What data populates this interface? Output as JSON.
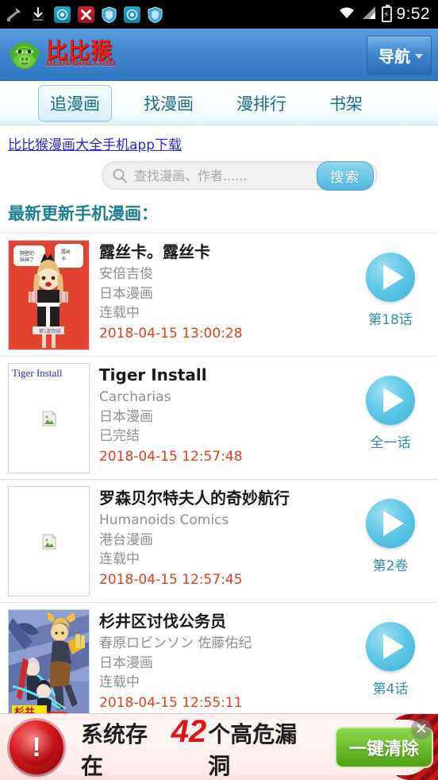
{
  "statusbar": {
    "time": "9:52",
    "icons": [
      "mute-arrow-icon",
      "download-icon",
      "app-cyan-icon",
      "app-red-x-icon",
      "shield-blue-icon",
      "app-cyan-icon-2",
      "shield-blue-icon-2"
    ],
    "right_icons": [
      "wifi-icon",
      "signal-icon",
      "battery-charging-icon"
    ]
  },
  "header": {
    "brand_cn": "比比猴",
    "brand_url": "m.bbhou.com",
    "nav_label": "导航"
  },
  "tabs": [
    {
      "label": "追漫画",
      "active": true
    },
    {
      "label": "找漫画",
      "active": false
    },
    {
      "label": "漫排行",
      "active": false
    },
    {
      "label": "书架",
      "active": false
    }
  ],
  "app_link": "比比猴漫画大全手机app下载",
  "search": {
    "placeholder": "查找漫画、作者......",
    "value": "",
    "button_label": "搜索"
  },
  "section_title": "最新更新手机漫画：",
  "list": [
    {
      "title": "露丝卡。露丝卡",
      "author": "安倍吉俊",
      "region": "日本漫画",
      "status": "连载中",
      "date": "2018-04-15 13:00:28",
      "episode": "第18话",
      "thumb_type": "cover-girl",
      "alt": ""
    },
    {
      "title": "Tiger Install",
      "author": "Carcharias",
      "region": "日本漫画",
      "status": "已完结",
      "date": "2018-04-15 12:57:48",
      "episode": "全一话",
      "thumb_type": "broken",
      "alt": "Tiger Install"
    },
    {
      "title": "罗森贝尔特夫人的奇妙航行",
      "author": "Humanoids Comics",
      "region": "港台漫画",
      "status": "连载中",
      "date": "2018-04-15 12:57:45",
      "episode": "第2卷",
      "thumb_type": "broken",
      "alt": ""
    },
    {
      "title": "杉井区讨伐公务员",
      "author": "春原ロビンソン 佐藤佑纪",
      "region": "日本漫画",
      "status": "连载中",
      "date": "2018-04-15 12:55:11",
      "episode": "第4话",
      "thumb_type": "cover-action",
      "alt": ""
    }
  ],
  "ad": {
    "text_before": "系统存在",
    "number": "42",
    "text_after": "个高危漏洞",
    "button_label": "一键清除",
    "close_label": "✕"
  },
  "colors": {
    "header_blue": "#3f86cf",
    "brand_red": "#e8201a",
    "tab_teal": "#1d6f86",
    "date_red": "#e2401c",
    "play_cyan": "#4fb7dd",
    "ad_green": "#4f9f16",
    "link_blue": "#2a2ad0"
  }
}
